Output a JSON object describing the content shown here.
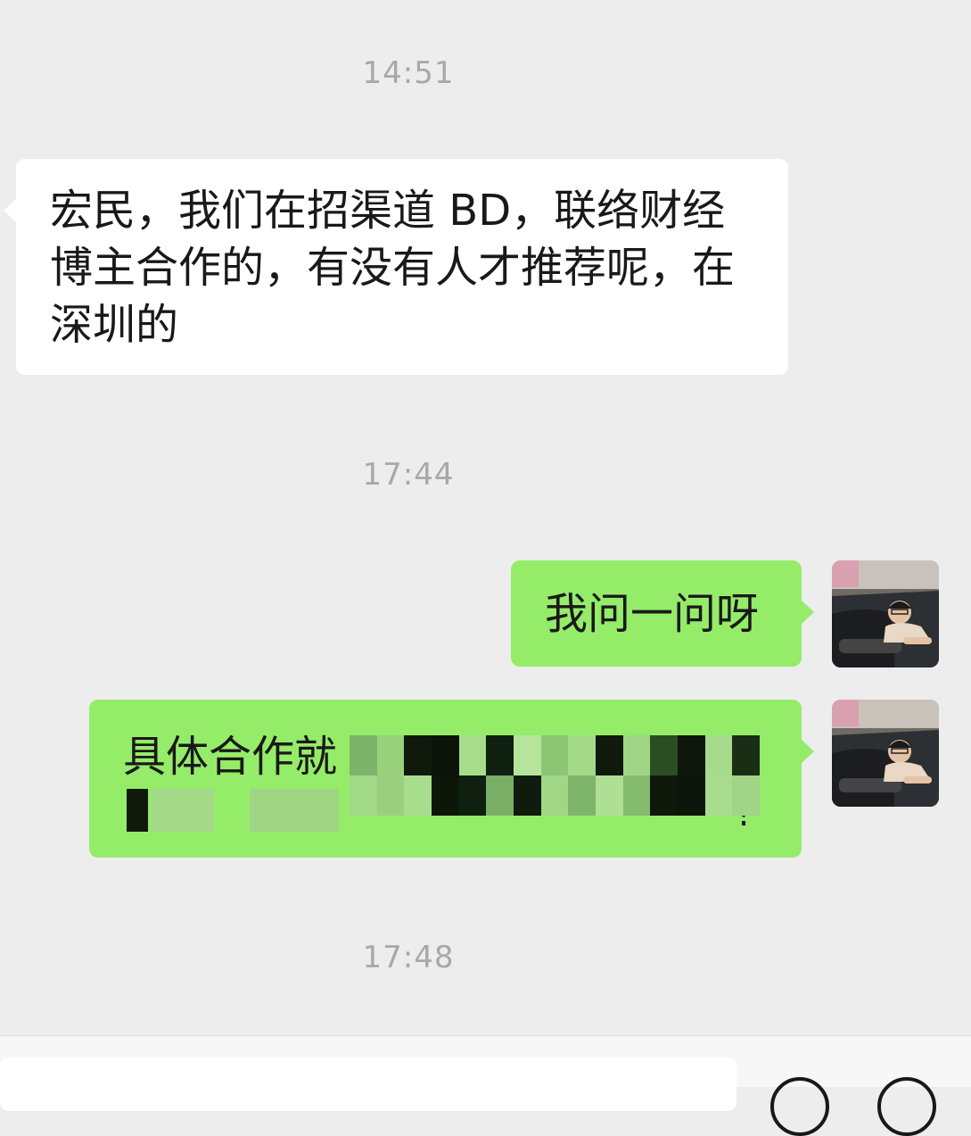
{
  "messages": [
    {
      "time": "14:51",
      "direction": "incoming",
      "lines": [
        "宏民，我们在招渠道 BD，联络财经",
        "博主合作的，有没有人才推荐呢，在",
        "深圳的"
      ]
    },
    {
      "time": "17:44",
      "direction": "outgoing",
      "lines": [
        "我问一问呀"
      ]
    },
    {
      "direction": "outgoing",
      "lines": [
        "具体合作就",
        "!"
      ],
      "redacted": true
    }
  ],
  "trailing_time": "17:48",
  "icons": {
    "avatar": "avatar-photo-icon",
    "voice": "voice-toggle-icon",
    "emoji": "emoji-icon",
    "more": "plus-icon"
  },
  "colors": {
    "background": "#ededed",
    "incoming_bubble": "#ffffff",
    "outgoing_bubble": "#95ec69",
    "timestamp": "#a8a8a8"
  }
}
